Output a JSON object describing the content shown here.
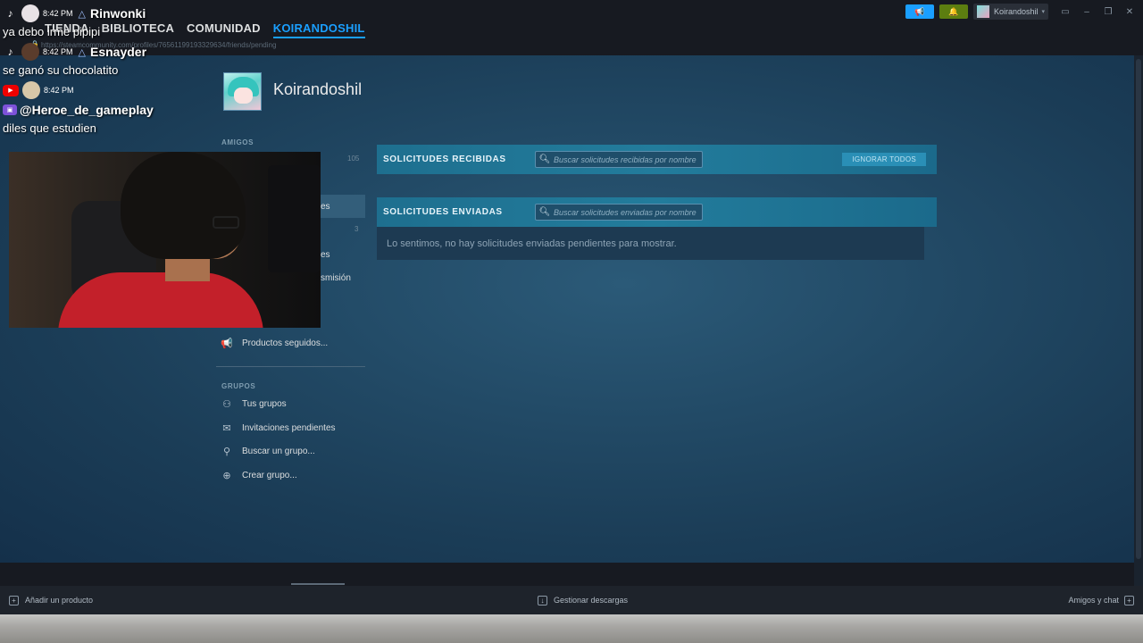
{
  "topnav": {
    "items": [
      {
        "label": "TIENDA",
        "active": false
      },
      {
        "label": "BIBLIOTECA",
        "active": false
      },
      {
        "label": "COMUNIDAD",
        "active": false
      },
      {
        "label": "KOIRANDOSHIL",
        "active": true
      }
    ],
    "url": "https://steamcommunity.com/profiles/76561199193329634/friends/pending"
  },
  "titlebar": {
    "username": "Koirandoshil"
  },
  "profile": {
    "name": "Koirandoshil"
  },
  "sidebar": {
    "friends_heading": "AMIGOS",
    "friends_count": "105",
    "partial_label_1": "es",
    "partial_count": "3",
    "partial_label_2": "es",
    "partial_label_3": "smisión",
    "followed_label": "Productos seguidos...",
    "groups_heading": "GRUPOS",
    "group_items": [
      {
        "label": "Tus grupos",
        "icon": "groups-icon"
      },
      {
        "label": "Invitaciones pendientes",
        "icon": "envelope-icon"
      },
      {
        "label": "Buscar un grupo...",
        "icon": "search-icon"
      },
      {
        "label": "Crear grupo...",
        "icon": "plus-circle-icon"
      }
    ]
  },
  "received": {
    "title": "SOLICITUDES RECIBIDAS",
    "search_placeholder": "Buscar solicitudes recibidas por nombre",
    "ignore_all": "IGNORAR TODOS"
  },
  "sent": {
    "title": "SOLICITUDES ENVIADAS",
    "search_placeholder": "Buscar solicitudes enviadas por nombre",
    "empty_message": "Lo sentimos, no hay solicitudes enviadas pendientes para mostrar."
  },
  "statusbar": {
    "add_product": "Añadir un producto",
    "manage_downloads": "Gestionar descargas",
    "friends_chat": "Amigos y chat"
  },
  "chat": [
    {
      "platform": "tiktok",
      "time": "8:42 PM",
      "user": "Rinwonki",
      "message": "ya debo irme pipipi",
      "avatar_color": "#e8e2e6"
    },
    {
      "platform": "tiktok",
      "time": "8:42 PM",
      "user": "Esnayder",
      "message": "se ganó su chocolatito",
      "avatar_color": "#5a3c2c"
    },
    {
      "platform": "youtube",
      "time": "8:42 PM",
      "user": "@Heroe_de_gameplay",
      "message": "diles que estudien",
      "avatar_color": "#d8c7a8"
    }
  ],
  "colors": {
    "accent": "#1a9fff",
    "panel_header": "#227c9c",
    "notification": "#5c7e10"
  }
}
